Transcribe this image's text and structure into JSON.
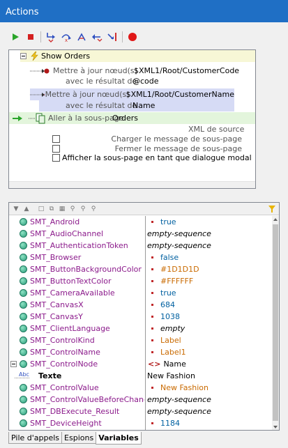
{
  "window": {
    "title": "Actions"
  },
  "toolbar": {
    "buttons": [
      {
        "icon": "run-icon"
      },
      {
        "icon": "stop-icon"
      },
      {
        "icon": "step-into-icon"
      },
      {
        "icon": "step-over-icon"
      },
      {
        "icon": "step-out-icon"
      },
      {
        "icon": "step-back-icon"
      },
      {
        "icon": "run-to-cursor-icon"
      },
      {
        "icon": "breakpoint-icon"
      }
    ]
  },
  "actions": {
    "group_label": "Show Orders",
    "update1": {
      "label": "Mettre à jour nœud(s)",
      "target": "$XML1/Root/CustomerCode",
      "result_label": "avec le résultat de",
      "result_value": "@code"
    },
    "update2": {
      "label": "Mettre à jour nœud(s)",
      "target": "$XML1/Root/CustomerName",
      "result_label": "avec le résultat de",
      "result_value": "Name"
    },
    "goto": {
      "label": "Aller à la sous-page",
      "value": "Orders"
    },
    "options": {
      "header": "XML de source",
      "load": "Charger le message de sous-page",
      "close": "Fermer le message de sous-page",
      "dialog": "Afficher la sous-page en tant que dialogue modal"
    }
  },
  "variables": [
    {
      "name": "SMT_Android",
      "value": "true",
      "type": "bool",
      "marker": true
    },
    {
      "name": "SMT_AudioChannel",
      "value": "empty-sequence",
      "type": "empty",
      "marker": false
    },
    {
      "name": "SMT_AuthenticationToken",
      "value": "empty-sequence",
      "type": "empty",
      "marker": false
    },
    {
      "name": "SMT_Browser",
      "value": "false",
      "type": "bool",
      "marker": true
    },
    {
      "name": "SMT_ButtonBackgroundColor",
      "value": "#1D1D1D",
      "type": "str",
      "marker": true
    },
    {
      "name": "SMT_ButtonTextColor",
      "value": "#FFFFFF",
      "type": "str",
      "marker": true
    },
    {
      "name": "SMT_CameraAvailable",
      "value": "true",
      "type": "bool",
      "marker": true
    },
    {
      "name": "SMT_CanvasX",
      "value": "684",
      "type": "num",
      "marker": true
    },
    {
      "name": "SMT_CanvasY",
      "value": "1038",
      "type": "num",
      "marker": true
    },
    {
      "name": "SMT_ClientLanguage",
      "value": "empty",
      "type": "empty",
      "marker": true
    },
    {
      "name": "SMT_ControlKind",
      "value": "Label",
      "type": "str",
      "marker": true
    },
    {
      "name": "SMT_ControlName",
      "value": "Label1",
      "type": "str",
      "marker": true
    },
    {
      "name": "SMT_ControlNode",
      "value": "Name",
      "type": "node",
      "marker": false
    },
    {
      "name": "Texte",
      "value": "New Fashion",
      "type": "text",
      "marker": false
    },
    {
      "name": "SMT_ControlValue",
      "value": "New Fashion",
      "type": "str",
      "marker": true
    },
    {
      "name": "SMT_ControlValueBeforeChang",
      "value": "empty-sequence",
      "type": "empty",
      "marker": false
    },
    {
      "name": "SMT_DBExecute_Result",
      "value": "empty-sequence",
      "type": "empty",
      "marker": false
    },
    {
      "name": "SMT_DeviceHeight",
      "value": "1184",
      "type": "num",
      "marker": true
    }
  ],
  "tabs": [
    {
      "label": "Pile d'appels",
      "active": false
    },
    {
      "label": "Espions",
      "active": false
    },
    {
      "label": "Variables",
      "active": true
    }
  ],
  "colors": {
    "titlebar": "#1f6fc5",
    "variable_name": "#8b1a8b",
    "string_value": "#c96a00",
    "number_value": "#0060a0",
    "selection": "#d6dbf5"
  }
}
